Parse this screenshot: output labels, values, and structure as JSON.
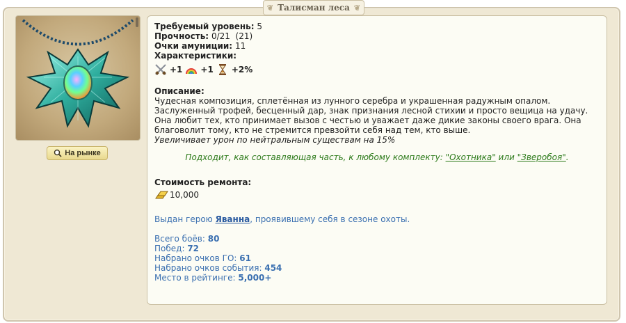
{
  "title": "Талисман леса",
  "item_image": {
    "icon": "maple-leaf-pendant-opal-icon"
  },
  "market_button": {
    "label": "На рынке",
    "icon": "magnifier-icon"
  },
  "stats": {
    "level_label": "Требуемый уровень:",
    "level_value": "5",
    "durability_label": "Прочность:",
    "durability_value": "0/21  (21)",
    "ammo_label": "Очки амуниции:",
    "ammo_value": "11",
    "characteristics_label": "Характеристики:",
    "bonuses": [
      {
        "icon": "crossed-swords-icon",
        "value": "+1"
      },
      {
        "icon": "rainbow-icon",
        "value": "+1"
      },
      {
        "icon": "hourglass-icon",
        "value": "+2%"
      }
    ]
  },
  "description": {
    "label": "Описание:",
    "text": "Чудесная композиция, сплетённая из лунного серебра и украшенная радужным опалом. Заслуженный трофей, бесценный дар, знак признания лесной стихии и просто вещица на удачу. Она любит тех, кто принимает вызов с честью и уважает даже дикие законы своего врага. Она благоволит тому, кто не стремится превзойти себя над тем, кто выше.",
    "effect": "Увеличивает урон по нейтральным существам на 15%"
  },
  "set_info": {
    "prefix": "Подходит, как составляющая часть, к любому комплекту: ",
    "set1": "\"Охотника\"",
    "between": " или ",
    "set2": "\"Зверобоя\"",
    "suffix": "."
  },
  "repair": {
    "label": "Стоимость ремонта:",
    "icon": "gold-bars-icon",
    "value": "10,000"
  },
  "award": {
    "prefix": "Выдан герою ",
    "hero": "Яванна",
    "suffix": ", проявившему себя в сезоне охоты."
  },
  "season_stats": [
    {
      "label": "Всего боёв: ",
      "value": "80"
    },
    {
      "label": "Побед: ",
      "value": "72"
    },
    {
      "label": "Набрано очков ГО: ",
      "value": "61"
    },
    {
      "label": "Набрано очков события: ",
      "value": "454"
    },
    {
      "label": "Место в рейтинге: ",
      "value": "5,000+"
    }
  ],
  "colors": {
    "frame_bg": "#efe8d4",
    "panel_bg": "#fcfcf4",
    "link_green": "#2c7a1a",
    "stat_blue": "#3a6fb0"
  }
}
